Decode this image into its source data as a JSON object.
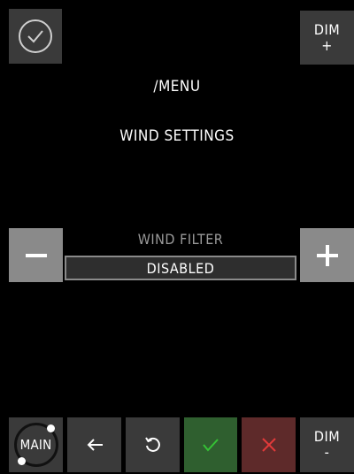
{
  "header": {
    "dim_up": {
      "label": "DIM",
      "sign": "+"
    },
    "menu_path": "/MENU",
    "menu_title": "WIND SETTINGS"
  },
  "setting": {
    "label": "WIND FILTER",
    "value": "DISABLED",
    "decrease_symbol": "−",
    "increase_symbol": "+"
  },
  "bottom_bar": {
    "main_label": "MAIN",
    "dim_down": {
      "label": "DIM",
      "sign": "-"
    }
  },
  "icons": {
    "confirm": "check-circle-icon",
    "back": "arrow-left-icon",
    "reset": "rotate-ccw-icon",
    "accept": "check-icon",
    "cancel": "close-icon"
  },
  "colors": {
    "accept": "#35c235",
    "cancel": "#e23a3a",
    "tile": "#3a3a3a",
    "stepper": "#8a8a8a"
  }
}
